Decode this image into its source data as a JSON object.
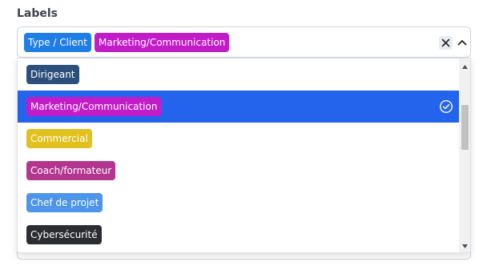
{
  "field": {
    "label": "Labels"
  },
  "selected_tags": [
    {
      "label": "Type / Client",
      "color": "#1f7de6"
    },
    {
      "label": "Marketing/Communication",
      "color": "#c21cc8"
    }
  ],
  "controls": {
    "clear_icon": "close-icon",
    "toggle_icon": "chevron-up-icon"
  },
  "options": [
    {
      "label": "Dirigeant",
      "color": "#2d4f7c",
      "selected": false
    },
    {
      "label": "Marketing/Communication",
      "color": "#c21cc8",
      "selected": true
    },
    {
      "label": "Commercial",
      "color": "#e2c11e",
      "selected": false
    },
    {
      "label": "Coach/formateur",
      "color": "#b3368e",
      "selected": false
    },
    {
      "label": "Chef de projet",
      "color": "#4c95e8",
      "selected": false
    },
    {
      "label": "Cybersécurité",
      "color": "#2b2d31",
      "selected": false
    }
  ],
  "colors": {
    "selected_row": "#2463eb"
  }
}
